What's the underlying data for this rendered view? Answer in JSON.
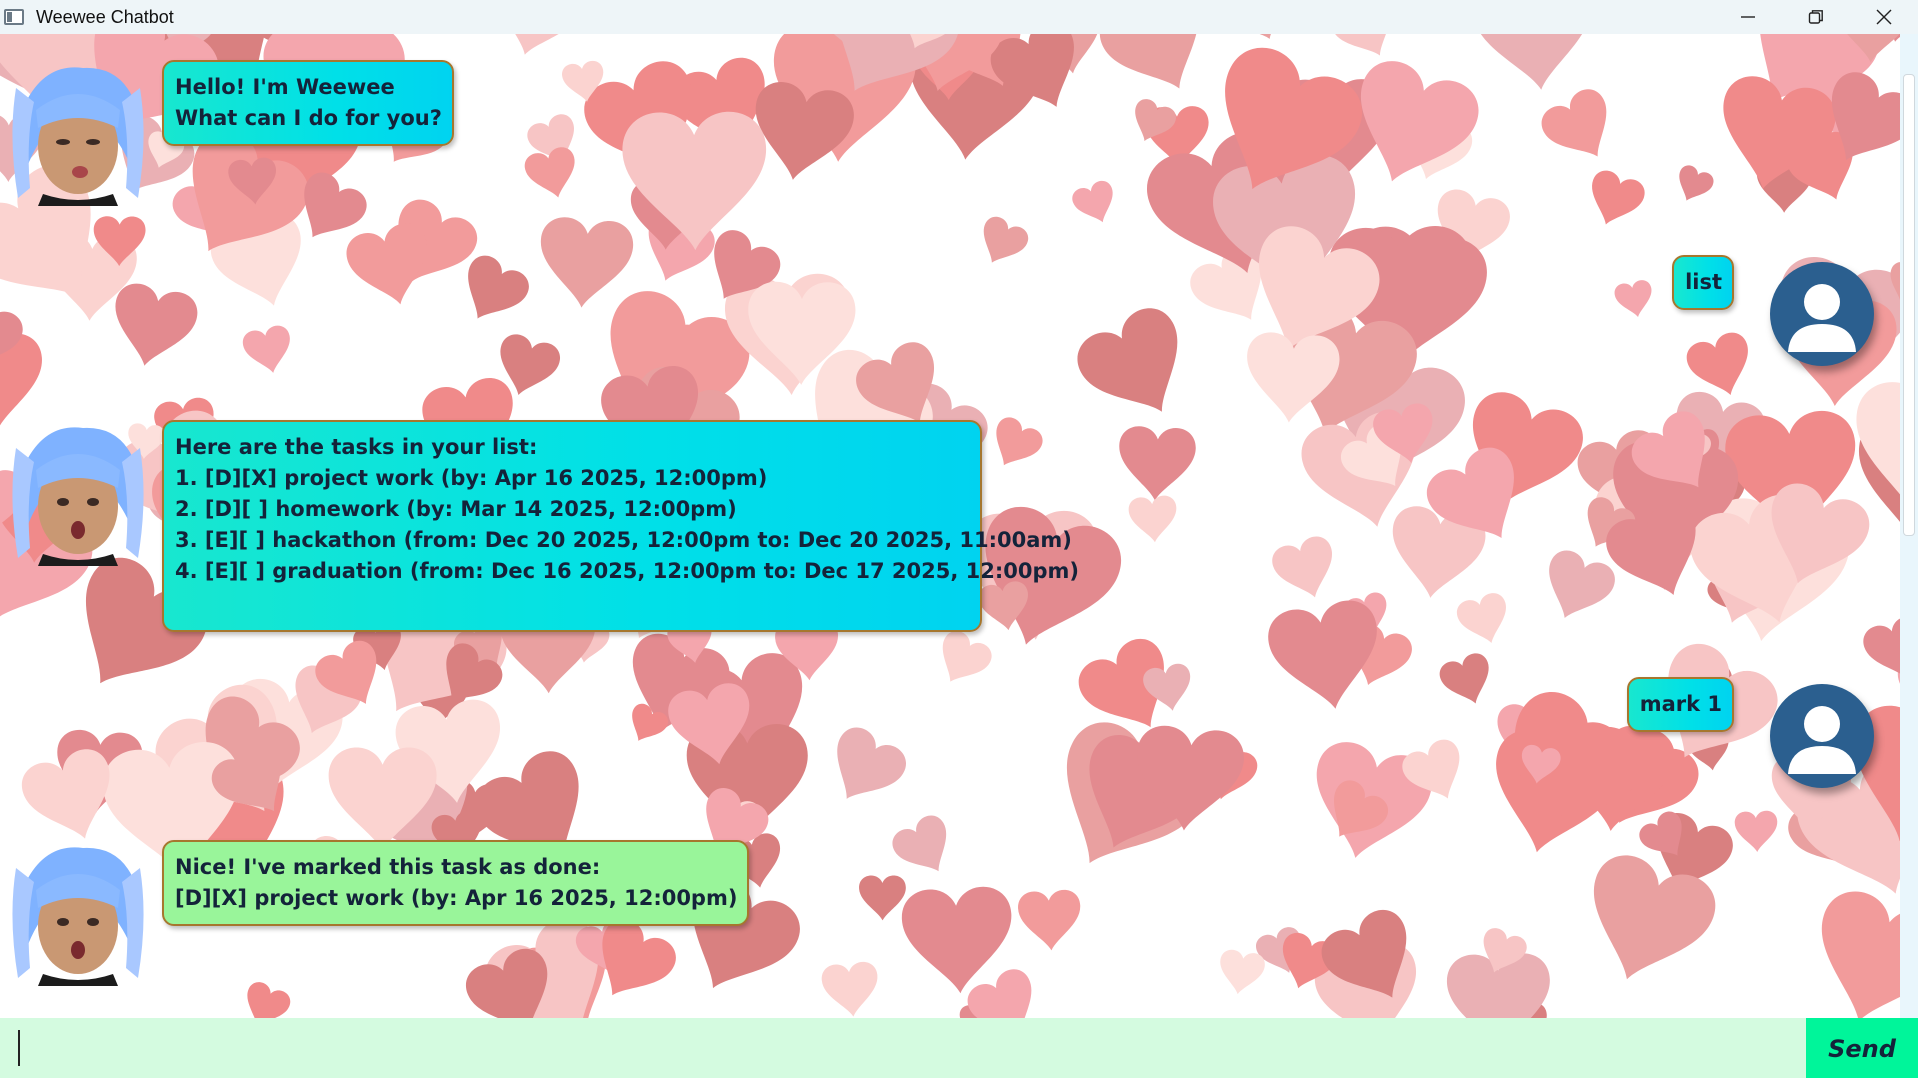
{
  "window": {
    "title": "Weewee Chatbot",
    "controls": {
      "minimize": "—",
      "maximize": "❐",
      "close": "✕"
    }
  },
  "chat": {
    "messages": [
      {
        "from": "bot",
        "text": "Hello! I'm Weewee\nWhat can I do for you?",
        "color": "cyan"
      },
      {
        "from": "user",
        "text": "list",
        "color": "cyan"
      },
      {
        "from": "bot",
        "text": "Here are the tasks in your list:\n1. [D][X] project work (by: Apr 16 2025, 12:00pm)\n2. [D][ ] homework (by: Mar 14 2025, 12:00pm)\n3. [E][ ] hackathon (from: Dec 20 2025, 12:00pm to: Dec 20 2025, 11:00am)\n4. [E][ ] graduation (from: Dec 16 2025, 12:00pm to: Dec 17 2025, 12:00pm)",
        "color": "cyan"
      },
      {
        "from": "user",
        "text": "mark 1",
        "color": "cyan"
      },
      {
        "from": "bot",
        "text": "Nice! I've marked this task as done:\n[D][X] project work (by: Apr 16 2025, 12:00pm)",
        "color": "green"
      }
    ]
  },
  "input": {
    "value": "",
    "placeholder": ""
  },
  "send_button": {
    "label": "Send"
  },
  "colors": {
    "bubble_cyan": "#00e0e8",
    "bubble_green": "#99f59a",
    "bubble_border": "#a6772e",
    "send_bg": "#00f59a",
    "input_bg": "#d4fbe0",
    "user_avatar": "#2b5f8f"
  }
}
